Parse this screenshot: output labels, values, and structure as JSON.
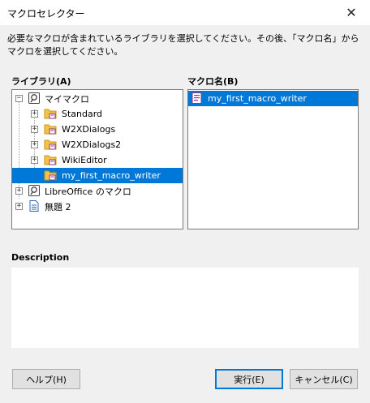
{
  "window": {
    "title": "マクロセレクター",
    "close_glyph": "✕"
  },
  "instruction": "必要なマクロが含まれているライブラリを選択してください。その後、「マクロ名」からマクロを選択してください。",
  "library": {
    "label": "ライブラリ(A)",
    "items": [
      {
        "label": "マイマクロ",
        "level": 0,
        "expander": "−",
        "icon": "macro-lib-icon"
      },
      {
        "label": "Standard",
        "level": 1,
        "expander": "+",
        "icon": "folder-icon"
      },
      {
        "label": "W2XDialogs",
        "level": 1,
        "expander": "+",
        "icon": "folder-icon"
      },
      {
        "label": "W2XDialogs2",
        "level": 1,
        "expander": "+",
        "icon": "folder-icon"
      },
      {
        "label": "WikiEditor",
        "level": 1,
        "expander": "+",
        "icon": "folder-icon"
      },
      {
        "label": "my_first_macro_writer",
        "level": 1,
        "expander": "",
        "icon": "folder-icon",
        "selected": true
      },
      {
        "label": "LibreOffice のマクロ",
        "level": 0,
        "expander": "+",
        "icon": "macro-lib-icon"
      },
      {
        "label": "無題 2",
        "level": 0,
        "expander": "+",
        "icon": "document-icon"
      }
    ]
  },
  "macro_name": {
    "label": "マクロ名(B)",
    "items": [
      {
        "label": "my_first_macro_writer",
        "selected": true
      }
    ]
  },
  "description": {
    "label": "Description",
    "text": ""
  },
  "buttons": {
    "help": "ヘルプ(H)",
    "run": "実行(E)",
    "cancel": "キャンセル(C)"
  },
  "colors": {
    "selection": "#0078d7",
    "folder": "#f5c242",
    "macro_icon": "#8a3a8a"
  }
}
